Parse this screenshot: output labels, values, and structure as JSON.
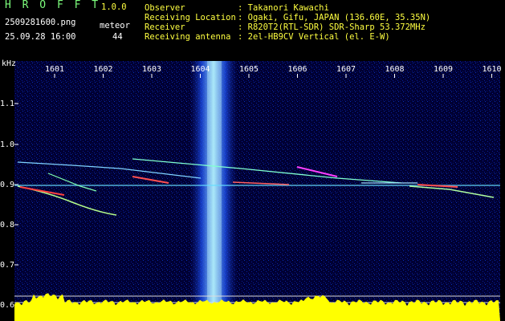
{
  "header": {
    "app_title": "H R O F F T",
    "version": "1.0.0",
    "filename": "2509281600.png",
    "datetime": "25.09.28 16:00",
    "meteor_label": "meteor",
    "meteor_count": "44",
    "info": [
      {
        "label": "Observer",
        "value": ": Takanori Kawachi"
      },
      {
        "label": "Receiving Location",
        "value": ": Ogaki, Gifu, JAPAN (136.60E, 35.35N)"
      },
      {
        "label": "Receiver",
        "value": ": R820T2(RTL-SDR) SDR-Sharp 53.372MHz"
      },
      {
        "label": "Receiving antenna",
        "value": ": 2el-HB9CV Vertical (el. E-W)"
      }
    ]
  },
  "axes": {
    "y_unit": "kHz",
    "x_ticks": [
      "1601",
      "1602",
      "1603",
      "1604",
      "1605",
      "1606",
      "1607",
      "1608",
      "1609",
      "1610"
    ],
    "y_ticks": [
      "1.1",
      "1.0",
      "0.9",
      "0.8",
      "0.7",
      "0.6"
    ]
  },
  "colors": {
    "background": "#000000",
    "spectrogram_bg": "#00003a",
    "noise_band": "#2b6bff",
    "carrier": "#66ddff",
    "meteor_hot": "#ff3a3a",
    "power_trace": "#ffff00",
    "text_green": "#7CFC7C",
    "text_yellow": "#FFFF40"
  }
}
